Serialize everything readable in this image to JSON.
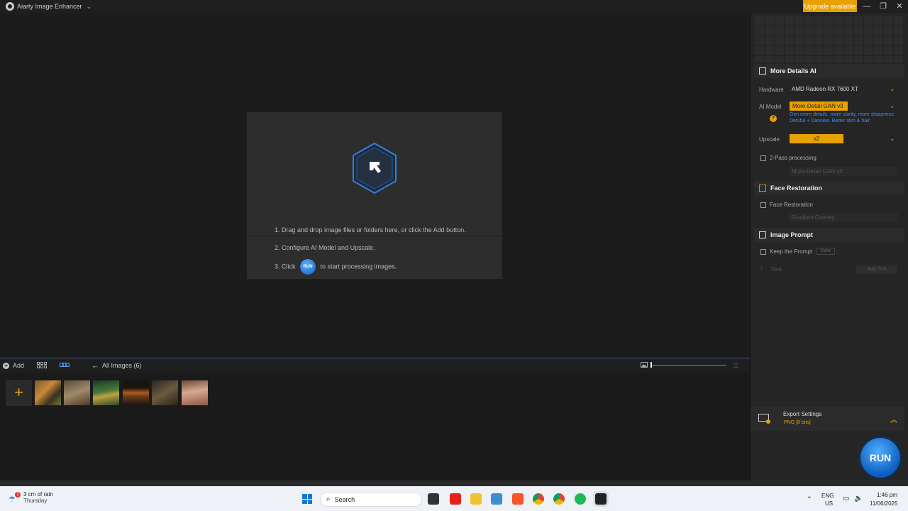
{
  "app": {
    "title": "Aiarty Image Enhancer",
    "upgrade_label": "Upgrade available",
    "window_controls": [
      "—",
      "❐",
      "✕"
    ]
  },
  "dropzone": {
    "step1": "1. Drag and drop image files or folders here, or click the Add button.",
    "step2": "2. Configure AI Model and Upscale.",
    "step3_prefix": "3. Click",
    "run_mini": "RUN",
    "step3_suffix": "to start processing images."
  },
  "tray": {
    "add_label": "Add",
    "all_images": "All Images (6)",
    "thumbnails": [
      "tiger",
      "owl",
      "forest-fairy",
      "burger",
      "tiger-warrior",
      "woman-portrait"
    ]
  },
  "panel": {
    "more_details": {
      "title": "More Details AI",
      "hardware_label": "Hardware",
      "hardware_value": "AMD Radeon RX 7600 XT",
      "ai_model_label": "AI Model",
      "ai_model_value": "More-Detail GAN  v3",
      "hint_line1": "Gen more details, more clarity, more sharpness",
      "hint_line2": "Detuful + Danoise. Better skin & hair",
      "upscale_label": "Upscale",
      "upscale_value": "x2",
      "two_pass_label": "2-Pass processing",
      "two_pass_model": "More-Detail GAN  v3"
    },
    "face_restoration": {
      "title": "Face Restoration",
      "checkbox_label": "Face Restoration",
      "model": "Gradient Overlay"
    },
    "image_prompt": {
      "title": "Image Prompt",
      "keep_label": "Keep the Prompt",
      "view_label": "View",
      "text_label": "Text",
      "add_text_label": "Add Text"
    },
    "export": {
      "title": "Export Settings",
      "format": "PNG   [8 bits]"
    },
    "run_label": "RUN"
  },
  "taskbar": {
    "weather_badge": "3",
    "weather_line1": "3 cm of rain",
    "weather_line2": "Thursday",
    "search_placeholder": "Search",
    "lang_line1": "ENG",
    "lang_line2": "US",
    "time": "1:46 pm",
    "date": "11/06/2025"
  },
  "colors": {
    "accent": "#e8a100",
    "run_blue": "#1a78e0",
    "panel_bg": "#252525",
    "canvas_bg": "#1c1c1c"
  }
}
